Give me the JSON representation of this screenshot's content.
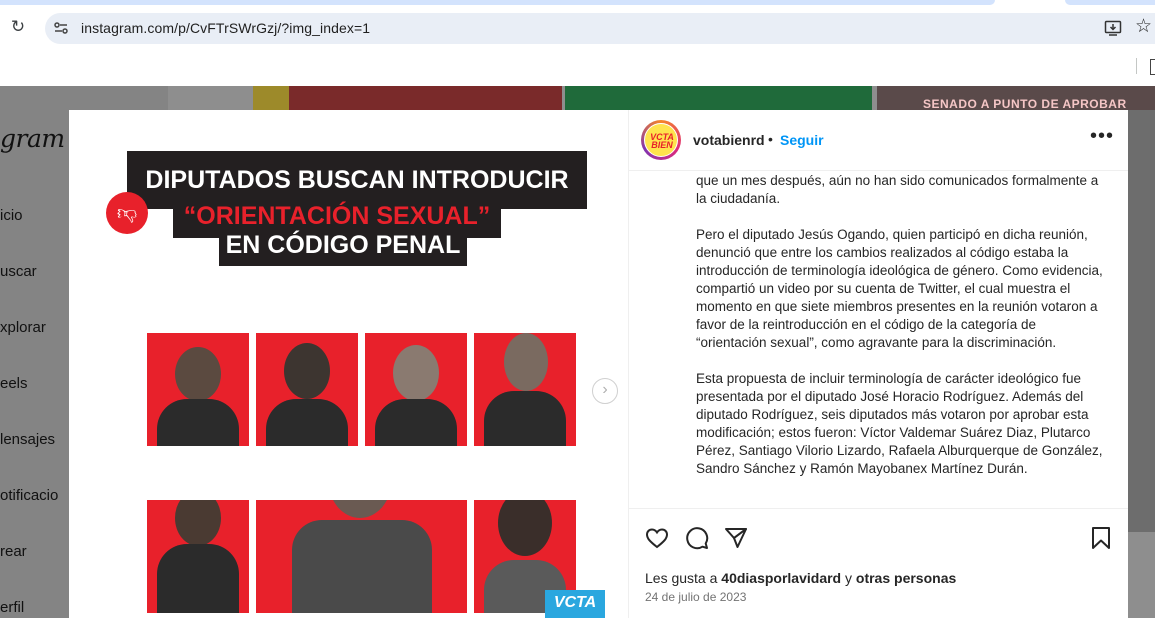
{
  "browser": {
    "url": "instagram.com/p/CvFTrSWrGzj/?img_index=1"
  },
  "background_page": {
    "logo": "gram",
    "nav": [
      "icio",
      "uscar",
      "xplorar",
      "eels",
      "lensajes",
      "otificacio",
      "rear",
      "erfil"
    ],
    "banner": "SENADO A PUNTO DE APROBAR"
  },
  "media": {
    "headline_line1": "DIPUTADOS BUSCAN INTRODUCIR",
    "headline_line2": "“ORIENTACIÓN SEXUAL”",
    "headline_line3": "EN CÓDIGO PENAL",
    "logo_text": "VCTA",
    "accent_color": "#e8212b"
  },
  "post": {
    "avatar_text": "VCTA BIEN",
    "username": "votabienrd",
    "separator": "•",
    "follow_label": "Seguir",
    "caption_paragraphs": [
      "que un mes después, aún no han sido comunicados formalmente a la ciudadanía.",
      "Pero el diputado Jesús Ogando, quien participó en dicha reunión, denunció que entre los cambios realizados al código estaba la introducción de terminología ideológica de género. Como evidencia, compartió un video por su cuenta de Twitter, el cual muestra el momento en que siete miembros presentes en la reunión votaron a favor de la reintroducción en el código de la categoría de “orientación sexual”, como agravante para la discriminación.",
      "Esta propuesta de incluir terminología de carácter ideológico fue presentada por el diputado José Horacio Rodríguez. Además del diputado Rodríguez, seis diputados más votaron por aprobar esta modificación; estos fueron: Víctor Valdemar Suárez Diaz, Plutarco Pérez, Santiago Vilorio Lizardo, Rafaela Alburquerque de González, Sandro Sánchez y Ramón Mayobanex Martínez Durán."
    ],
    "likes_prefix": "Les gusta a",
    "likes_user": "40diasporlavidard",
    "likes_conj": "y",
    "likes_others": "otras personas",
    "date": "24 de julio de 2023"
  }
}
